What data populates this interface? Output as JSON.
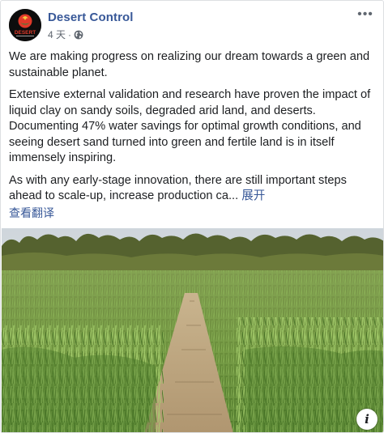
{
  "post": {
    "author": "Desert Control",
    "avatar_logo_text": "DESERT",
    "timestamp": "4 天",
    "separator": "·",
    "audience_icon": "globe-icon",
    "more_icon": "more-options-icon",
    "more_label": "•••",
    "paragraphs": [
      "We are making progress on realizing our dream towards a green and sustainable planet.",
      "Extensive external validation and research have proven the impact of liquid clay on sandy soils, degraded arid land, and deserts. Documenting 47% water savings for optimal growth conditions, and seeing desert sand turned into green and fertile land is in itself immensely inspiring.",
      "As with any early-stage innovation, there are still important steps ahead to scale-up, increase production ca..."
    ],
    "see_more": "展开",
    "see_translation": "查看翻译",
    "photo_icon": "info-icon",
    "info_label": "i"
  },
  "colors": {
    "link": "#385898",
    "text": "#1c1e21",
    "meta": "#606770",
    "avatar_bg": "#0d0d0d",
    "avatar_accent": "#e03a2a"
  }
}
